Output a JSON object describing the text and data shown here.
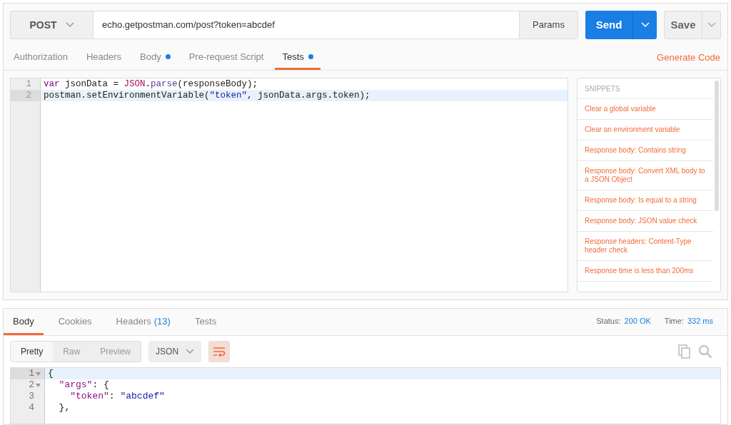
{
  "request": {
    "method": "POST",
    "url": "echo.getpostman.com/post?token=abcdef",
    "params": "Params",
    "send": "Send",
    "save": "Save"
  },
  "request_tabs": [
    {
      "label": "Authorization",
      "selected": false,
      "dot": false
    },
    {
      "label": "Headers",
      "selected": false,
      "dot": false
    },
    {
      "label": "Body",
      "selected": false,
      "dot": true
    },
    {
      "label": "Pre-request Script",
      "selected": false,
      "dot": false
    },
    {
      "label": "Tests",
      "selected": true,
      "dot": true
    }
  ],
  "generate_code": "Generate Code",
  "test_editor": {
    "lines": [
      {
        "number": "1",
        "active": false,
        "tokens": [
          {
            "kind": "keyword",
            "text": "var"
          },
          {
            "kind": "plain",
            "text": " jsonData = "
          },
          {
            "kind": "builtin",
            "text": "JSON"
          },
          {
            "kind": "plain",
            "text": "."
          },
          {
            "kind": "property",
            "text": "parse"
          },
          {
            "kind": "plain",
            "text": "(responseBody);"
          }
        ]
      },
      {
        "number": "2",
        "active": true,
        "tokens": [
          {
            "kind": "plain",
            "text": "postman.setEnvironmentVariable("
          },
          {
            "kind": "string",
            "text": "\"token\""
          },
          {
            "kind": "plain",
            "text": ", jsonData.args.token);"
          }
        ]
      }
    ]
  },
  "snippets": {
    "title": "SNIPPETS",
    "items": [
      "Clear a global variable",
      "Clear an environment variable",
      "Response body: Contains string",
      "Response body: Convert XML body to a JSON Object",
      "Response body: Is equal to a string",
      "Response body: JSON value check",
      "Response headers: Content-Type header check",
      "Response time is less than 200ms"
    ]
  },
  "response": {
    "tabs": [
      {
        "label": "Body",
        "selected": true
      },
      {
        "label": "Cookies",
        "selected": false
      },
      {
        "label": "Headers",
        "count": "(13)",
        "selected": false
      },
      {
        "label": "Tests",
        "selected": false
      }
    ],
    "status_label": "Status:",
    "status": "200 OK",
    "time_label": "Time:",
    "time": "332 ms",
    "view_modes": [
      {
        "label": "Pretty",
        "selected": true
      },
      {
        "label": "Raw",
        "selected": false
      },
      {
        "label": "Preview",
        "selected": false
      }
    ],
    "format": "JSON",
    "lines": [
      {
        "number": "1",
        "foldable": true,
        "active": true,
        "tokens": [
          {
            "kind": "plain",
            "text": "{"
          }
        ]
      },
      {
        "number": "2",
        "foldable": true,
        "active": false,
        "tokens": [
          {
            "kind": "key",
            "text": "  \"args\""
          },
          {
            "kind": "plain",
            "text": ": {"
          }
        ]
      },
      {
        "number": "3",
        "foldable": false,
        "active": false,
        "tokens": [
          {
            "kind": "key",
            "text": "    \"token\""
          },
          {
            "kind": "plain",
            "text": ": "
          },
          {
            "kind": "string",
            "text": "\"abcdef\""
          }
        ]
      },
      {
        "number": "4",
        "foldable": false,
        "active": false,
        "tokens": [
          {
            "kind": "plain",
            "text": "  },"
          }
        ]
      }
    ]
  }
}
